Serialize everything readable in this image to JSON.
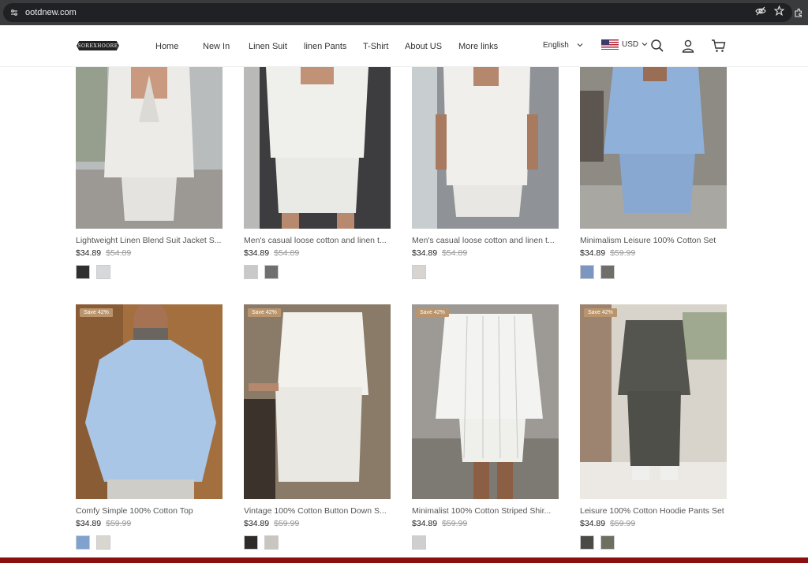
{
  "browser": {
    "url": "ootdnew.com"
  },
  "header": {
    "logo": "SOREXHOORE",
    "nav": [
      "Home",
      "New In",
      "Linen Suit",
      "linen Pants",
      "T-Shirt",
      "About US",
      "More links"
    ],
    "language": "English",
    "currency": "USD"
  },
  "products": [
    {
      "title": "Lightweight Linen Blend Suit Jacket S...",
      "price": "$34.89",
      "old": "$54.89",
      "badge": "",
      "swatches": [
        "#2f2f2f",
        "#d6d9dc"
      ]
    },
    {
      "title": "Men's casual loose cotton and linen t...",
      "price": "$34.89",
      "old": "$54.89",
      "badge": "",
      "swatches": [
        "#c9c9c9",
        "#6f6f6f"
      ]
    },
    {
      "title": "Men's casual loose cotton and linen t...",
      "price": "$34.89",
      "old": "$54.89",
      "badge": "",
      "swatches": [
        "#d8d4cf"
      ]
    },
    {
      "title": "Minimalism Leisure 100% Cotton Set",
      "price": "$34.89",
      "old": "$59.99",
      "badge": "",
      "swatches": [
        "#7b97c1",
        "#6e6e6a"
      ]
    },
    {
      "title": "Comfy Simple 100% Cotton Top",
      "price": "$34.89",
      "old": "$59.99",
      "badge": "Save 42%",
      "swatches": [
        "#7fa2cf",
        "#d9d6cf"
      ]
    },
    {
      "title": "Vintage 100% Cotton Button Down S...",
      "price": "$34.89",
      "old": "$59.99",
      "badge": "Save 42%",
      "swatches": [
        "#2e2b28",
        "#c9c6c0"
      ]
    },
    {
      "title": "Minimalist 100% Cotton Striped Shir...",
      "price": "$34.89",
      "old": "$59.99",
      "badge": "Save 42%",
      "swatches": [
        "#cfcfcf"
      ]
    },
    {
      "title": "Leisure 100% Cotton Hoodie Pants Set",
      "price": "$34.89",
      "old": "$59.99",
      "badge": "Save 42%",
      "swatches": [
        "#4a4a47",
        "#6b7060"
      ]
    }
  ],
  "colors": {
    "badge": "#b9946c",
    "accent_bar": "#8b0f0f"
  }
}
